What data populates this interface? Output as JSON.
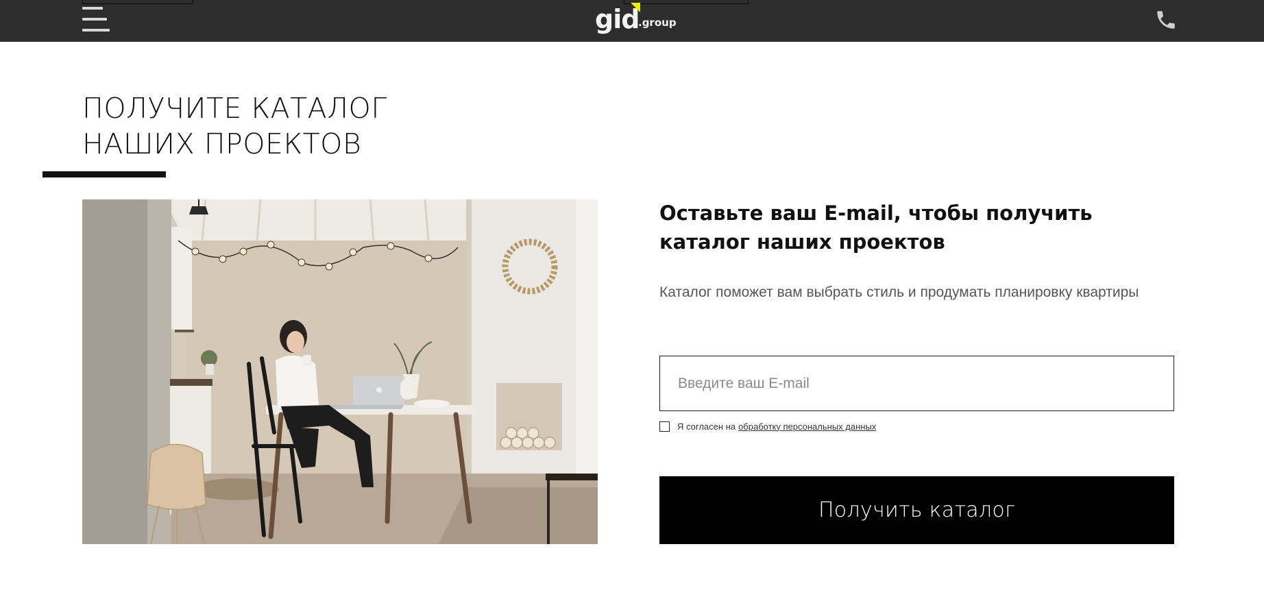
{
  "header": {
    "logo_main": "gid",
    "logo_sub": ".group",
    "menu_icon": "hamburger-menu-icon",
    "phone_icon": "phone-icon"
  },
  "section": {
    "title_line1": "ПОЛУЧИТЕ КАТАЛОГ",
    "title_line2": "НАШИХ ПРОЕКТОВ"
  },
  "form": {
    "heading": "Оставьте ваш E-mail, чтобы получить каталог наших проектов",
    "description": "Каталог поможет вам выбрать стиль и продумать планировку квартиры",
    "email_placeholder": "Введите ваш E-mail",
    "email_value": "",
    "consent_checked": false,
    "consent_text": "Я согласен на",
    "consent_link": "обработку персональных данных",
    "submit_label": "Получить каталог"
  },
  "colors": {
    "header_bg": "#2d2d2d",
    "logo_accent": "#e8f000",
    "button_bg": "#000000",
    "button_text": "#ffffff"
  }
}
